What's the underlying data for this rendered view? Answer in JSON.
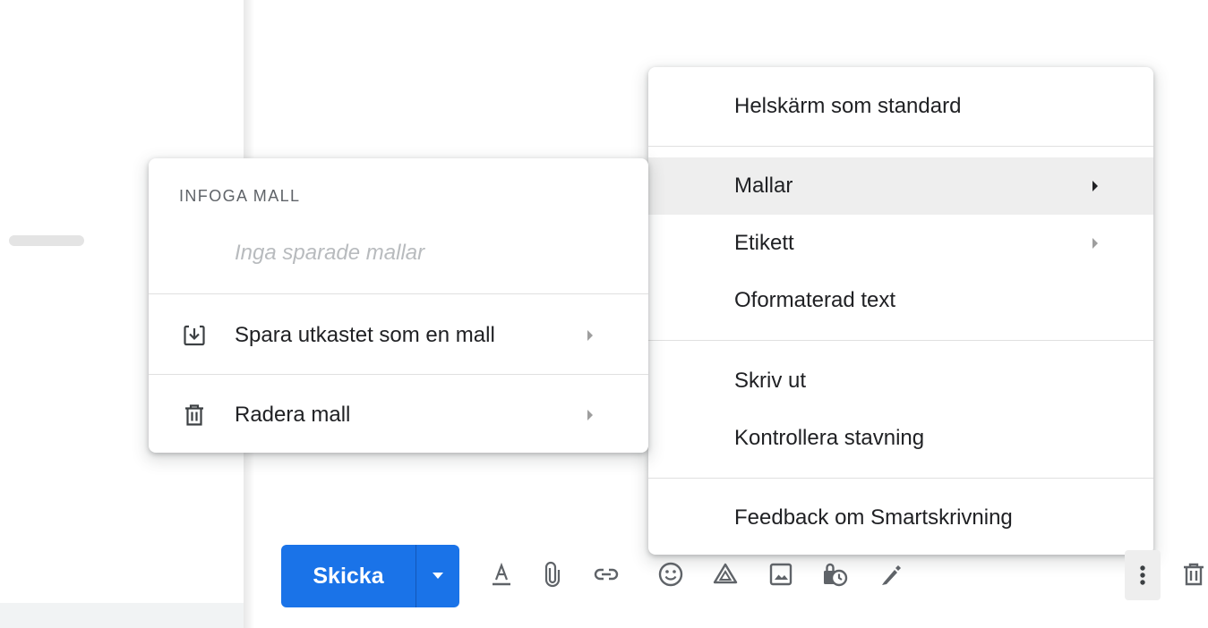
{
  "main_menu": {
    "items": [
      {
        "label": "Helskärm som standard"
      },
      {
        "label": "Mallar",
        "submenu": true,
        "highlighted": true
      },
      {
        "label": "Etikett",
        "submenu": true
      },
      {
        "label": "Oformaterad text"
      },
      {
        "label": "Skriv ut"
      },
      {
        "label": "Kontrollera stavning"
      },
      {
        "label": "Feedback om Smartskrivning"
      }
    ]
  },
  "templates_menu": {
    "header": "INFOGA MALL",
    "empty_text": "Inga sparade mallar",
    "items": [
      {
        "label": "Spara utkastet som en mall",
        "icon": "save-draft-icon",
        "submenu": true
      },
      {
        "label": "Radera mall",
        "icon": "trash-icon",
        "submenu": true
      }
    ]
  },
  "toolbar": {
    "send_label": "Skicka",
    "icons": [
      "format-text-icon",
      "attach-icon",
      "link-icon",
      "emoji-icon",
      "drive-icon",
      "photo-icon",
      "confidential-mode-icon",
      "signature-icon",
      "more-options-icon",
      "discard-icon"
    ]
  },
  "colors": {
    "accent": "#1a73e8",
    "highlight": "#eeeeee",
    "text": "#202124",
    "muted": "#5f6368"
  }
}
